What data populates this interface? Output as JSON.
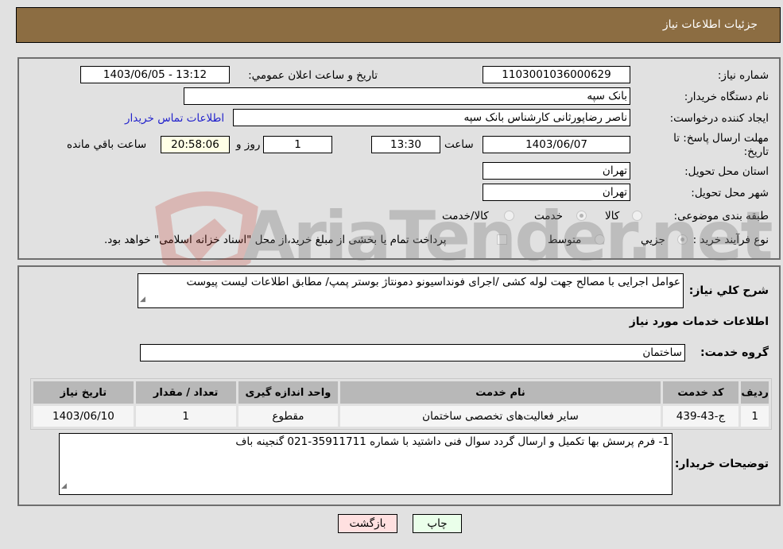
{
  "header": {
    "title": "جزئیات اطلاعات نیاز"
  },
  "info": {
    "need_number_label": "شماره نیاز:",
    "need_number": "1103001036000629",
    "announce_label": "تاریخ و ساعت اعلان عمومي:",
    "announce_value": "1403/06/05 - 13:12",
    "buyer_org_label": "نام دستگاه خریدار:",
    "buyer_org": "بانک سپه",
    "creator_label": "ایجاد کننده درخواست:",
    "creator": "ناصر رضاپورثانی کارشناس بانک سپه",
    "contact_link": "اطلاعات تماس خریدار",
    "deadline_label": "مهلت ارسال پاسخ: تا تاریخ:",
    "deadline_date": "1403/06/07",
    "time_label": "ساعت",
    "deadline_time": "13:30",
    "days_value": "1",
    "days_label": "روز و",
    "remaining_time": "20:58:06",
    "remaining_label": "ساعت باقي مانده",
    "province_label": "استان محل تحویل:",
    "province": "تهران",
    "city_label": "شهر محل تحویل:",
    "city": "تهران",
    "category_label": "طبقه بندی موضوعی:",
    "category_options": [
      {
        "label": "کالا",
        "checked": false
      },
      {
        "label": "خدمت",
        "checked": true
      },
      {
        "label": "کالا/خدمت",
        "checked": false
      }
    ],
    "process_label": "نوع فرآیند خرید :",
    "process_options": [
      {
        "label": "جزيي",
        "checked": true
      },
      {
        "label": "متوسط",
        "checked": false
      }
    ],
    "treasury_note": "پرداخت تمام یا بخشی از مبلغ خرید،از محل \"اسناد خزانه اسلامی\" خواهد بود."
  },
  "description": {
    "label": "شرح کلي نیاز:",
    "text": "عوامل اجرایی با مصالح جهت لوله کشی /اجرای فونداسیونو دمونتاژ بوستر پمپ/ مطابق اطلاعات لیست پیوست"
  },
  "services": {
    "section_title": "اطلاعات خدمات مورد نیاز",
    "group_label": "گروه خدمت:",
    "group_value": "ساختمان",
    "columns": [
      "ردیف",
      "کد خدمت",
      "نام خدمت",
      "واحد اندازه گیری",
      "تعداد / مقدار",
      "تاریخ نیاز"
    ],
    "rows": [
      [
        "1",
        "ج-43-439",
        "سایر فعالیت‌های تخصصی ساختمان",
        "مقطوع",
        "1",
        "1403/06/10"
      ]
    ]
  },
  "buyer_notes": {
    "label": "توضیحات خریدار:",
    "text": "1- فرم پرسش بها تکمیل و ارسال گردد سوال فنی داشتید با شماره 35911711-021 گنجینه باف"
  },
  "buttons": {
    "print": "چاپ",
    "back": "بازگشت"
  },
  "watermark": {
    "text": "AriaTender.net",
    "brand_color": "#c0392b"
  },
  "colors": {
    "header_bg": "#8c6d42",
    "link": "#2222cc"
  }
}
